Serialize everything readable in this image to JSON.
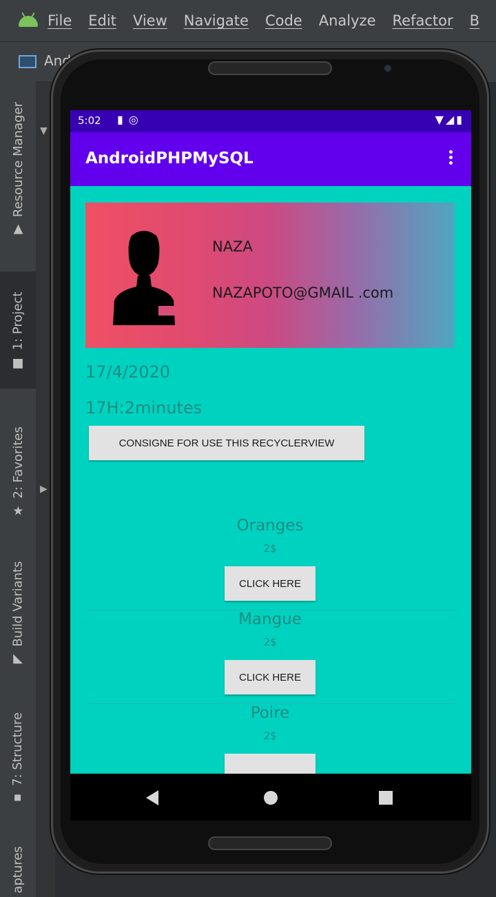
{
  "ide": {
    "menu": [
      "File",
      "Edit",
      "View",
      "Navigate",
      "Code",
      "Analyze",
      "Refactor",
      "B"
    ],
    "project_label": "And",
    "side_tabs": [
      {
        "label": "Resource Manager",
        "icon": "resource-manager-icon"
      },
      {
        "label": "1: Project",
        "icon": "folder-icon"
      },
      {
        "label": "2: Favorites",
        "icon": "star-icon"
      },
      {
        "label": "Build Variants",
        "icon": "build-variants-icon"
      },
      {
        "label": "7: Structure",
        "icon": "structure-icon"
      },
      {
        "label": "aptures",
        "icon": ""
      }
    ]
  },
  "device": {
    "status_bar": {
      "time": "5:02"
    },
    "app_bar": {
      "title": "AndroidPHPMySQL"
    },
    "profile": {
      "name": "NAZA",
      "email": "NAZAPOTO@GMAIL .com"
    },
    "date": "17/4/2020",
    "time_text": "17H:2minutes",
    "consigne_button": "CONSIGNE FOR USE THIS RECYCLERVIEW",
    "items": [
      {
        "name": "Oranges",
        "price": "2$",
        "button": "CLICK HERE"
      },
      {
        "name": "Mangue",
        "price": "2$",
        "button": "CLICK HERE"
      },
      {
        "name": "Poire",
        "price": "2$",
        "button": ""
      }
    ]
  },
  "colors": {
    "status_bar": "#3700b3",
    "app_bar": "#6200ee",
    "background": "#00d2c0",
    "text_teal": "#1e8c82"
  }
}
